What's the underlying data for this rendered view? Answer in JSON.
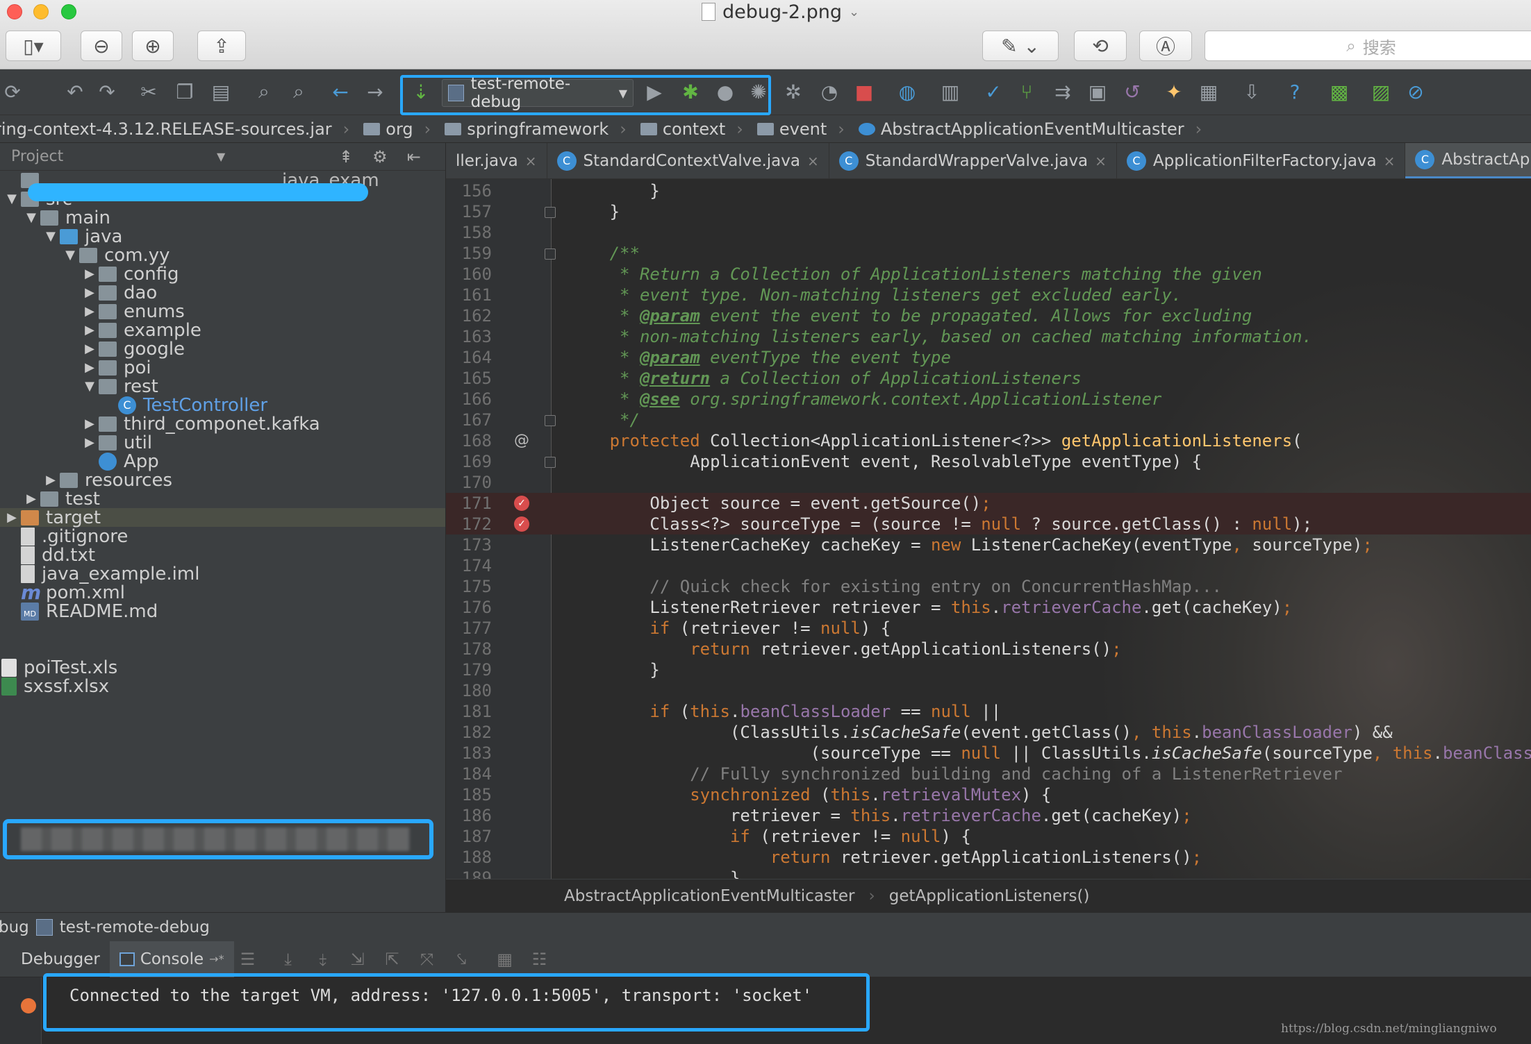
{
  "window": {
    "title": "debug-2.png",
    "search_placeholder": "搜索"
  },
  "toolbar": {
    "run_configuration": "test-remote-debug"
  },
  "navbar": {
    "crumbs": [
      "ring-context-4.3.12.RELEASE-sources.jar",
      "org",
      "springframework",
      "context",
      "event",
      "AbstractApplicationEventMulticaster"
    ]
  },
  "project": {
    "header_title": "Project",
    "tree": [
      {
        "label": "java_exam",
        "depth": 0,
        "arrow": "",
        "icon": "folder"
      },
      {
        "label": "src",
        "depth": 0,
        "arrow": "▼",
        "icon": "folder"
      },
      {
        "label": "main",
        "depth": 1,
        "arrow": "▼",
        "icon": "folder"
      },
      {
        "label": "java",
        "depth": 2,
        "arrow": "▼",
        "icon": "java"
      },
      {
        "label": "com.yy",
        "depth": 3,
        "arrow": "▼",
        "icon": "folder"
      },
      {
        "label": "config",
        "depth": 4,
        "arrow": "▶",
        "icon": "folder"
      },
      {
        "label": "dao",
        "depth": 4,
        "arrow": "▶",
        "icon": "folder"
      },
      {
        "label": "enums",
        "depth": 4,
        "arrow": "▶",
        "icon": "folder"
      },
      {
        "label": "example",
        "depth": 4,
        "arrow": "▶",
        "icon": "folder"
      },
      {
        "label": "google",
        "depth": 4,
        "arrow": "▶",
        "icon": "folder"
      },
      {
        "label": "poi",
        "depth": 4,
        "arrow": "▶",
        "icon": "folder"
      },
      {
        "label": "rest",
        "depth": 4,
        "arrow": "▼",
        "icon": "folder"
      },
      {
        "label": "TestController",
        "depth": 5,
        "arrow": "",
        "icon": "class"
      },
      {
        "label": "third_componet.kafka",
        "depth": 4,
        "arrow": "▶",
        "icon": "folder"
      },
      {
        "label": "util",
        "depth": 4,
        "arrow": "▶",
        "icon": "folder"
      },
      {
        "label": "App",
        "depth": 4,
        "arrow": "",
        "icon": "app"
      },
      {
        "label": "resources",
        "depth": 2,
        "arrow": "▶",
        "icon": "folder"
      },
      {
        "label": "test",
        "depth": 1,
        "arrow": "▶",
        "icon": "folder"
      },
      {
        "label": "target",
        "depth": 0,
        "arrow": "▶",
        "icon": "target"
      },
      {
        "label": ".gitignore",
        "depth": 0,
        "arrow": "",
        "icon": "file"
      },
      {
        "label": "dd.txt",
        "depth": 0,
        "arrow": "",
        "icon": "file"
      },
      {
        "label": "java_example.iml",
        "depth": 0,
        "arrow": "",
        "icon": "file"
      },
      {
        "label": "pom.xml",
        "depth": 0,
        "arrow": "",
        "icon": "maven"
      },
      {
        "label": "README.md",
        "depth": 0,
        "arrow": "",
        "icon": "md"
      },
      {
        "label": "",
        "depth": 0,
        "arrow": "",
        "icon": "none"
      },
      {
        "label": "",
        "depth": 0,
        "arrow": "",
        "icon": "none"
      },
      {
        "label": "poiTest.xls",
        "depth": -1,
        "arrow": "",
        "icon": "xls"
      },
      {
        "label": "sxssf.xlsx",
        "depth": -1,
        "arrow": "",
        "icon": "xlsx"
      }
    ]
  },
  "editor": {
    "tabs": [
      {
        "label": "ller.java",
        "icon": false
      },
      {
        "label": "StandardContextValve.java",
        "icon": true
      },
      {
        "label": "StandardWrapperValve.java",
        "icon": true
      },
      {
        "label": "ApplicationFilterFactory.java",
        "icon": true
      },
      {
        "label": "AbstractApplicationEv",
        "icon": true
      }
    ],
    "lines": [
      {
        "n": "156",
        "t": [
          [
            "            }",
            ""
          ]
        ]
      },
      {
        "n": "157",
        "t": [
          [
            "        }",
            ""
          ]
        ],
        "fold": true
      },
      {
        "n": "158",
        "t": []
      },
      {
        "n": "159",
        "t": [
          [
            "        /**",
            "cm"
          ]
        ],
        "fold": true
      },
      {
        "n": "160",
        "t": [
          [
            "         * Return a Collection of ApplicationListeners matching the given",
            "cm"
          ]
        ]
      },
      {
        "n": "161",
        "t": [
          [
            "         * event type. Non-matching listeners get excluded early.",
            "cm"
          ]
        ]
      },
      {
        "n": "162",
        "t": [
          [
            "         * ",
            "cm"
          ],
          [
            "@param",
            "cmtag"
          ],
          [
            " event the event to be propagated. Allows for excluding",
            "cm"
          ]
        ]
      },
      {
        "n": "163",
        "t": [
          [
            "         * non-matching listeners early, based on cached matching information.",
            "cm"
          ]
        ]
      },
      {
        "n": "164",
        "t": [
          [
            "         * ",
            "cm"
          ],
          [
            "@param",
            "cmtag"
          ],
          [
            " eventType the event type",
            "cm"
          ]
        ]
      },
      {
        "n": "165",
        "t": [
          [
            "         * ",
            "cm"
          ],
          [
            "@return",
            "cmtag"
          ],
          [
            " a Collection of ApplicationListeners",
            "cm"
          ]
        ]
      },
      {
        "n": "166",
        "t": [
          [
            "         * ",
            "cm"
          ],
          [
            "@see",
            "cmtag"
          ],
          [
            " org.springframework.context.ApplicationListener",
            "cm"
          ]
        ]
      },
      {
        "n": "167",
        "t": [
          [
            "         */",
            "cm"
          ]
        ],
        "fold": true
      },
      {
        "n": "168",
        "mark": "@",
        "t": [
          [
            "        ",
            ""
          ],
          [
            "protected",
            "kw"
          ],
          [
            " Collection<ApplicationListener<?>> ",
            ""
          ],
          [
            "getApplicationListeners",
            "fn"
          ],
          [
            "(",
            ""
          ]
        ]
      },
      {
        "n": "169",
        "t": [
          [
            "                ApplicationEvent event, ResolvableType eventType) {",
            ""
          ]
        ],
        "fold": true
      },
      {
        "n": "170",
        "t": []
      },
      {
        "n": "171",
        "bp": true,
        "t": [
          [
            "            Object source = event.getSource()",
            ""
          ],
          [
            ";",
            "kw"
          ]
        ]
      },
      {
        "n": "172",
        "bp": true,
        "t": [
          [
            "            Class<?> sourceType = (source != ",
            ""
          ],
          [
            "null",
            "kw"
          ],
          [
            " ? source.getClass() : ",
            ""
          ],
          [
            "null",
            "kw"
          ],
          [
            ");",
            ""
          ]
        ]
      },
      {
        "n": "173",
        "t": [
          [
            "            ListenerCacheKey cacheKey = ",
            ""
          ],
          [
            "new",
            "kw"
          ],
          [
            " ListenerCacheKey(eventType",
            ""
          ],
          [
            ",",
            "kw"
          ],
          [
            " sourceType)",
            ""
          ],
          [
            ";",
            "kw"
          ]
        ]
      },
      {
        "n": "174",
        "t": []
      },
      {
        "n": "175",
        "t": [
          [
            "            // Quick check for existing entry on ConcurrentHashMap...",
            "lc"
          ]
        ]
      },
      {
        "n": "176",
        "t": [
          [
            "            ListenerRetriever retriever = ",
            ""
          ],
          [
            "this",
            "kw"
          ],
          [
            ".",
            ""
          ],
          [
            "retrieverCache",
            "fld"
          ],
          [
            ".get(cacheKey)",
            ""
          ],
          [
            ";",
            "kw"
          ]
        ]
      },
      {
        "n": "177",
        "t": [
          [
            "            ",
            ""
          ],
          [
            "if",
            "kw"
          ],
          [
            " (retriever != ",
            ""
          ],
          [
            "null",
            "kw"
          ],
          [
            ") {",
            ""
          ]
        ]
      },
      {
        "n": "178",
        "t": [
          [
            "                ",
            ""
          ],
          [
            "return",
            "kw"
          ],
          [
            " retriever.getApplicationListeners()",
            ""
          ],
          [
            ";",
            "kw"
          ]
        ]
      },
      {
        "n": "179",
        "t": [
          [
            "            }",
            ""
          ]
        ]
      },
      {
        "n": "180",
        "t": []
      },
      {
        "n": "181",
        "t": [
          [
            "            ",
            ""
          ],
          [
            "if",
            "kw"
          ],
          [
            " (",
            ""
          ],
          [
            "this",
            "kw"
          ],
          [
            ".",
            ""
          ],
          [
            "beanClassLoader",
            "fld"
          ],
          [
            " == ",
            ""
          ],
          [
            "null",
            "kw"
          ],
          [
            " ||",
            ""
          ]
        ]
      },
      {
        "n": "182",
        "t": [
          [
            "                    (ClassUtils.",
            ""
          ],
          [
            "isCacheSafe",
            "it"
          ],
          [
            "(event.getClass()",
            ""
          ],
          [
            ",",
            "kw"
          ],
          [
            " ",
            ""
          ],
          [
            "this",
            "kw"
          ],
          [
            ".",
            ""
          ],
          [
            "beanClassLoader",
            "fld"
          ],
          [
            ") &&",
            ""
          ]
        ]
      },
      {
        "n": "183",
        "t": [
          [
            "                            (sourceType == ",
            ""
          ],
          [
            "null",
            "kw"
          ],
          [
            " || ClassUtils.",
            ""
          ],
          [
            "isCacheSafe",
            "it"
          ],
          [
            "(sourceType",
            ""
          ],
          [
            ",",
            "kw"
          ],
          [
            " ",
            ""
          ],
          [
            "this",
            "kw"
          ],
          [
            ".",
            ""
          ],
          [
            "beanClassLoad",
            "fld"
          ]
        ]
      },
      {
        "n": "184",
        "t": [
          [
            "                // Fully synchronized building and caching of a ListenerRetriever",
            "lc"
          ]
        ]
      },
      {
        "n": "185",
        "t": [
          [
            "                ",
            ""
          ],
          [
            "synchronized",
            "kw"
          ],
          [
            " (",
            ""
          ],
          [
            "this",
            "kw"
          ],
          [
            ".",
            ""
          ],
          [
            "retrievalMutex",
            "fld"
          ],
          [
            ") {",
            ""
          ]
        ]
      },
      {
        "n": "186",
        "t": [
          [
            "                    retriever = ",
            ""
          ],
          [
            "this",
            "kw"
          ],
          [
            ".",
            ""
          ],
          [
            "retrieverCache",
            "fld"
          ],
          [
            ".get(cacheKey)",
            ""
          ],
          [
            ";",
            "kw"
          ]
        ]
      },
      {
        "n": "187",
        "t": [
          [
            "                    ",
            ""
          ],
          [
            "if",
            "kw"
          ],
          [
            " (retriever != ",
            ""
          ],
          [
            "null",
            "kw"
          ],
          [
            ") {",
            ""
          ]
        ]
      },
      {
        "n": "188",
        "t": [
          [
            "                        ",
            ""
          ],
          [
            "return",
            "kw"
          ],
          [
            " retriever.getApplicationListeners()",
            ""
          ],
          [
            ";",
            "kw"
          ]
        ]
      },
      {
        "n": "189",
        "t": [
          [
            "                    }",
            ""
          ]
        ]
      }
    ],
    "footer_class": "AbstractApplicationEventMulticaster",
    "footer_method": "getApplicationListeners()"
  },
  "debug": {
    "window_prefix": "bug",
    "config_name": "test-remote-debug",
    "tab_debugger": "Debugger",
    "tab_console": "Console",
    "console_text": "Connected to the target VM, address: '127.0.0.1:5005', transport: 'socket'"
  },
  "watermark": "https://blog.csdn.net/mingliangniwo",
  "colors": {
    "keyword": "#cc7832",
    "comment": "#629755",
    "method": "#ffc66d",
    "field": "#9876aa",
    "highlight": "#29a8ff",
    "breakpoint": "#d84d4d"
  }
}
